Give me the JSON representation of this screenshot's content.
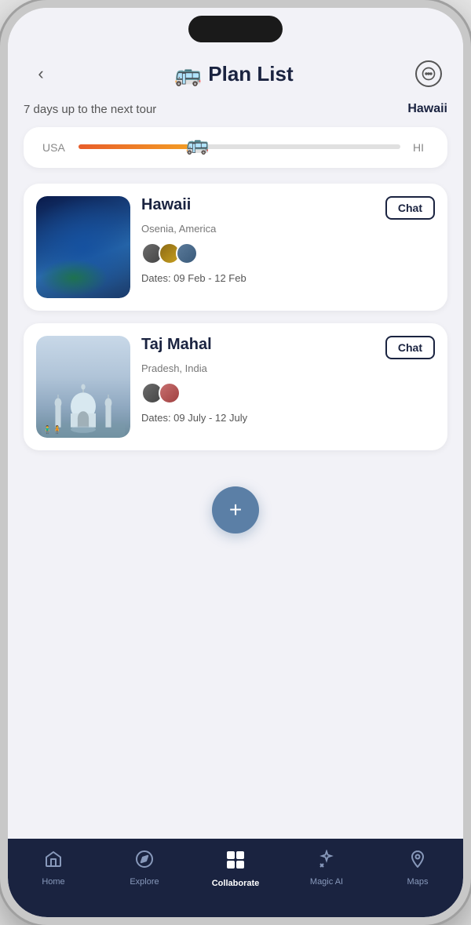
{
  "header": {
    "title": "Plan List",
    "bus_icon": "🚌",
    "back_label": "‹",
    "chat_icon": "💬"
  },
  "countdown": {
    "days_text": "7 days up to the next tour",
    "destination": "Hawaii",
    "from": "USA",
    "to": "HI",
    "progress_pct": 40
  },
  "plans": [
    {
      "id": "hawaii",
      "name": "Hawaii",
      "location": "Osenia, America",
      "dates": "Dates: 09 Feb - 12 Feb",
      "chat_label": "Chat",
      "avatars": 3
    },
    {
      "id": "tajmahal",
      "name": "Taj Mahal",
      "location": "Pradesh, India",
      "dates": "Dates: 09 July -  12 July",
      "chat_label": "Chat",
      "avatars": 2
    }
  ],
  "add_button": "+",
  "nav": {
    "items": [
      {
        "id": "home",
        "label": "Home",
        "icon": "⌂",
        "active": false
      },
      {
        "id": "explore",
        "label": "Explore",
        "icon": "◎",
        "active": false
      },
      {
        "id": "collaborate",
        "label": "Collaborate",
        "icon": "grid",
        "active": true
      },
      {
        "id": "magic_ai",
        "label": "Magic AI",
        "icon": "✦",
        "active": false
      },
      {
        "id": "maps",
        "label": "Maps",
        "icon": "◉",
        "active": false
      }
    ]
  }
}
